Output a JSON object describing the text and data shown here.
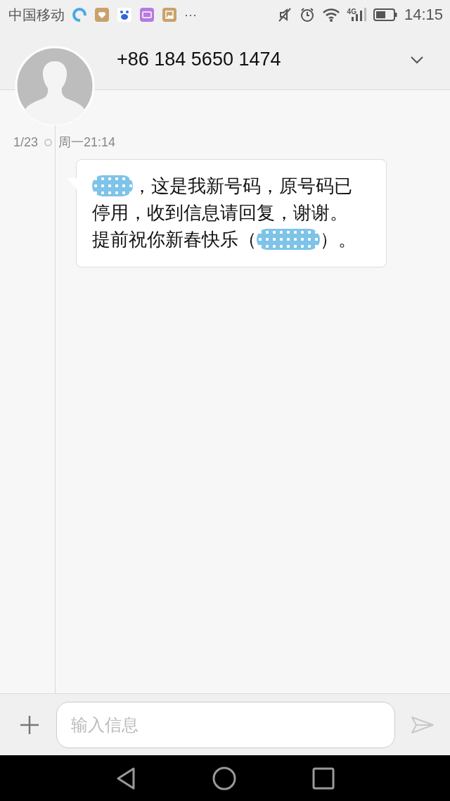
{
  "status_bar": {
    "carrier": "中国移动",
    "notifications": [
      {
        "kind": "browser"
      },
      {
        "kind": "health"
      },
      {
        "kind": "baidu"
      },
      {
        "kind": "keyboard"
      },
      {
        "kind": "gallery"
      }
    ],
    "more": "···",
    "network": "4G",
    "time": "14:15"
  },
  "header": {
    "contact": "+86 184 5650 1474",
    "expanded": false
  },
  "thread": {
    "date": "1/23",
    "time": "周一21:14",
    "message": [
      {
        "kind": "redaction"
      },
      {
        "kind": "text",
        "text": "，这是我新号码，原号码已停用，收到信息请回复，谢谢。提前祝你新春快乐（"
      },
      {
        "kind": "redaction"
      },
      {
        "kind": "text",
        "text": "）。"
      }
    ]
  },
  "composer": {
    "placeholder": "输入信息"
  }
}
